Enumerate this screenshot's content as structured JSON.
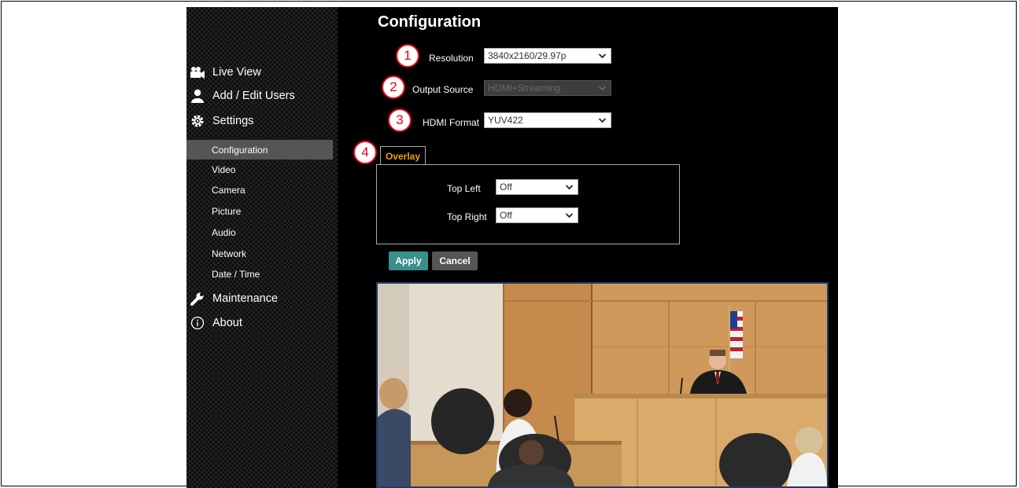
{
  "page": {
    "title": "Configuration"
  },
  "sidebar": {
    "items": [
      {
        "label": "Live View",
        "icon": "video-camera-icon"
      },
      {
        "label": "Add / Edit Users",
        "icon": "user-icon"
      },
      {
        "label": "Settings",
        "icon": "gear-icon"
      },
      {
        "label": "Maintenance",
        "icon": "wrench-icon"
      },
      {
        "label": "About",
        "icon": "info-icon"
      }
    ],
    "settings_sub": [
      "Configuration",
      "Video",
      "Camera",
      "Picture",
      "Audio",
      "Network",
      "Date / Time"
    ],
    "active_sub": "Configuration"
  },
  "form": {
    "resolution": {
      "label": "Resolution",
      "value": "3840x2160/29.97p"
    },
    "output_source": {
      "label": "Output Source",
      "value": "HDMI+Streaming",
      "disabled": true
    },
    "hdmi_format": {
      "label": "HDMI Format",
      "value": "YUV422"
    }
  },
  "overlay": {
    "tab_label": "Overlay",
    "top_left": {
      "label": "Top Left",
      "value": "Off"
    },
    "top_right": {
      "label": "Top Right",
      "value": "Off"
    }
  },
  "buttons": {
    "apply": "Apply",
    "cancel": "Cancel"
  },
  "markers": [
    "1",
    "2",
    "3",
    "4"
  ],
  "colors": {
    "accent_tab": "#f39c12",
    "apply_bg": "#3a8f8c",
    "cancel_bg": "#555555",
    "marker": "#e3001b"
  }
}
